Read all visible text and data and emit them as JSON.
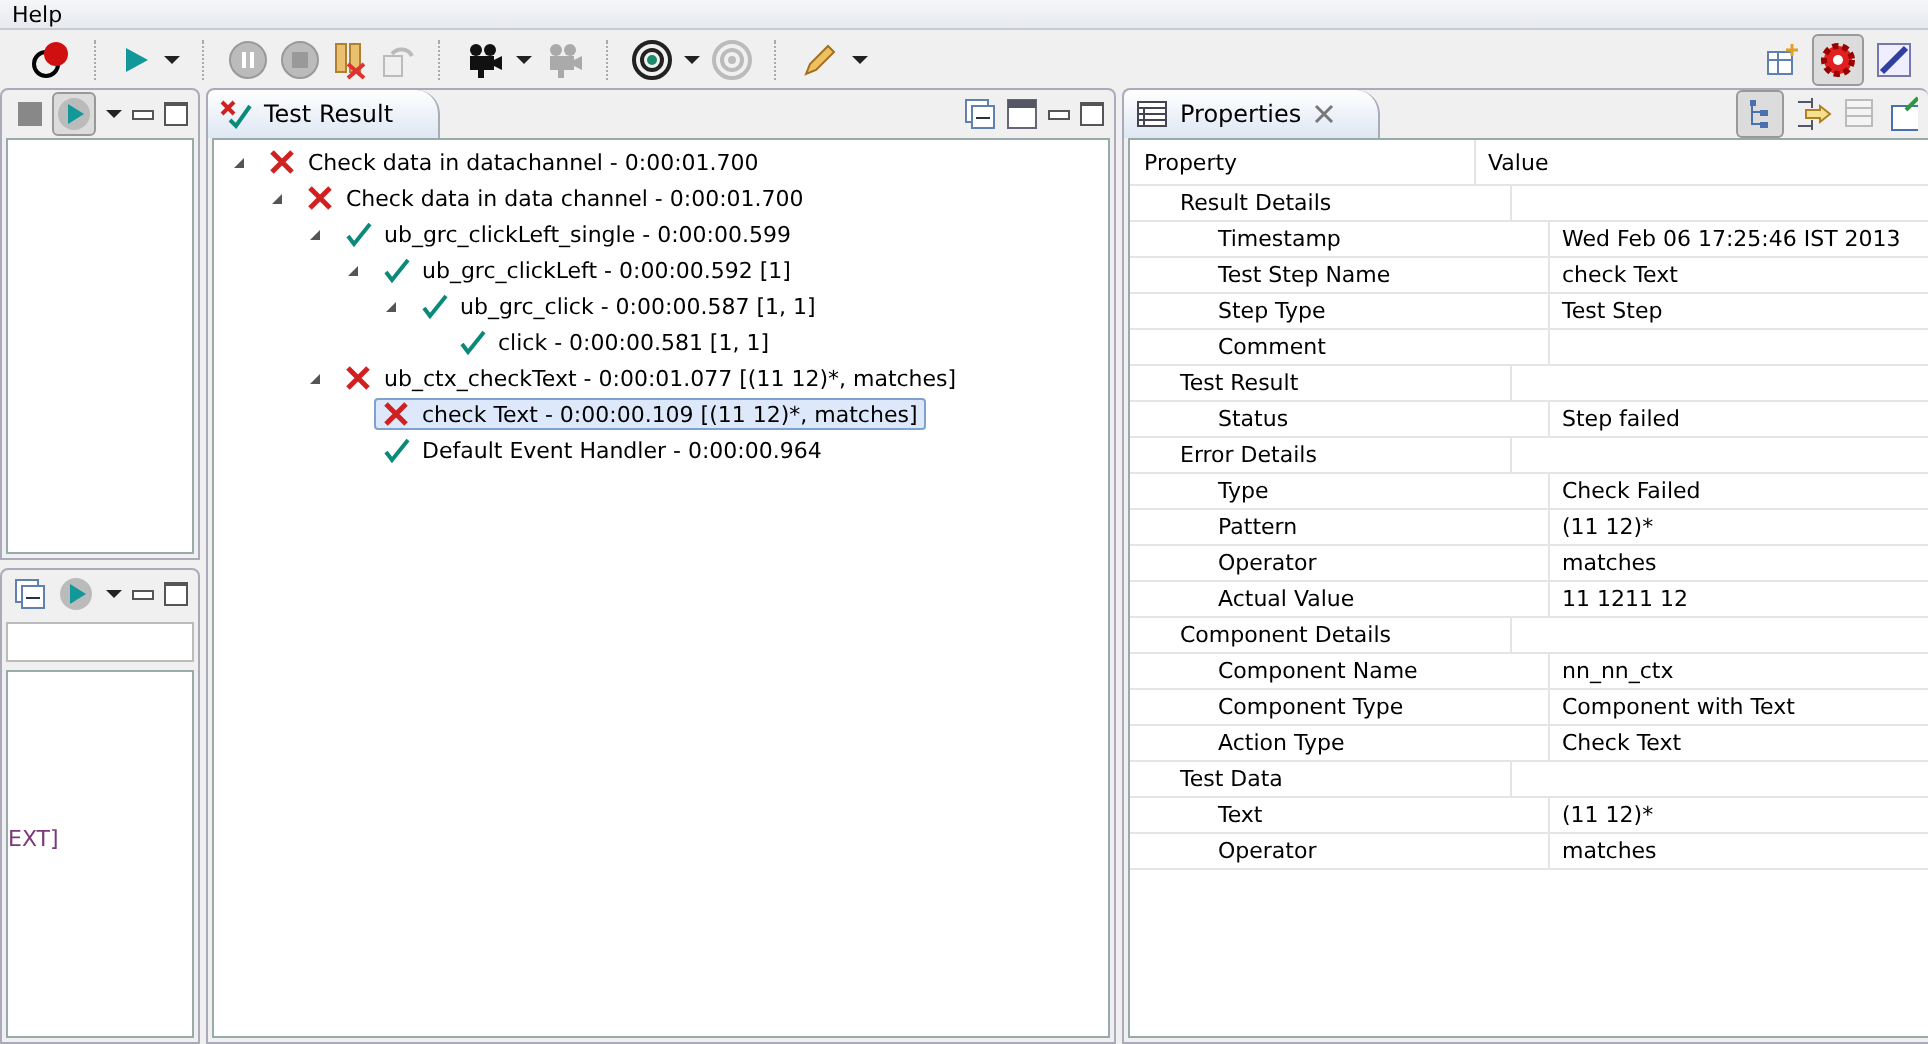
{
  "menu": {
    "items": [
      "Help"
    ]
  },
  "test_result": {
    "title": "Test Result",
    "tree": [
      {
        "label": "Check data in datachannel - 0:00:01.700",
        "kind": "failed",
        "expanded": true,
        "selected": false,
        "children": [
          {
            "label": "Check data in data channel - 0:00:01.700",
            "kind": "failed",
            "expanded": true,
            "selected": false,
            "children": [
              {
                "label": "ub_grc_clickLeft_single - 0:00:00.599",
                "kind": "passed",
                "expanded": true,
                "selected": false,
                "children": [
                  {
                    "label": "ub_grc_clickLeft - 0:00:00.592 [1]",
                    "kind": "passed",
                    "expanded": true,
                    "selected": false,
                    "children": [
                      {
                        "label": "ub_grc_click - 0:00:00.587 [1, 1]",
                        "kind": "passed",
                        "expanded": true,
                        "selected": false,
                        "children": [
                          {
                            "label": "click - 0:00:00.581 [1, 1]",
                            "kind": "passed",
                            "selected": false
                          }
                        ]
                      }
                    ]
                  }
                ]
              },
              {
                "label": "ub_ctx_checkText - 0:00:01.077 [(11 12)*, matches]",
                "kind": "failed",
                "expanded": true,
                "selected": false,
                "children": [
                  {
                    "label": "check Text - 0:00:00.109 [(11 12)*, matches]",
                    "kind": "failed",
                    "selected": true
                  },
                  {
                    "label": "Default Event Handler - 0:00:00.964",
                    "kind": "passed",
                    "selected": false
                  }
                ]
              }
            ]
          }
        ]
      }
    ]
  },
  "properties": {
    "title": "Properties",
    "columns": [
      "Property",
      "Value"
    ],
    "sections": [
      {
        "name": "Result Details",
        "children": [
          {
            "name": "Timestamp",
            "value": "Wed Feb 06 17:25:46 IST 2013"
          },
          {
            "name": "Test Step Name",
            "value": "check Text"
          },
          {
            "name": "Step Type",
            "value": "Test Step"
          },
          {
            "name": "Comment"
          }
        ]
      },
      {
        "name": "Test Result",
        "children": [
          {
            "name": "Status",
            "value": "Step failed"
          }
        ]
      },
      {
        "name": "Error Details",
        "children": [
          {
            "name": "Type",
            "value": "Check Failed"
          },
          {
            "name": "Pattern",
            "value": "(11 12)*"
          },
          {
            "name": "Operator",
            "value": "matches"
          },
          {
            "name": "Actual Value",
            "value": "11 1211 12"
          }
        ]
      },
      {
        "name": "Component Details",
        "children": [
          {
            "name": "Component Name",
            "value": "nn_nn_ctx"
          },
          {
            "name": "Component Type",
            "value": "Component with Text"
          },
          {
            "name": "Action Type",
            "value": "Check Text"
          }
        ]
      },
      {
        "name": "Test Data",
        "children": [
          {
            "name": "Text",
            "value": "(11 12)*"
          },
          {
            "name": "Operator",
            "value": "matches"
          }
        ]
      }
    ]
  },
  "left_bottom": {
    "text": "EXT]"
  }
}
